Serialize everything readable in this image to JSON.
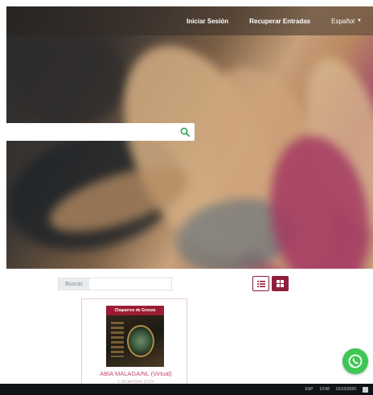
{
  "nav": {
    "login": "Iniciar Sesión",
    "recover": "Recuperar Entradas",
    "language": "Español"
  },
  "search": {
    "placeholder": "",
    "value": ""
  },
  "filter": {
    "label": "Buscar",
    "value": ""
  },
  "card": {
    "banner": "Chaparros de Gronzo",
    "title": "ABIA MALAGA/NL (Virtual)",
    "subtitle": "1 diciembre 2020"
  },
  "taskbar": {
    "lang": "ESP",
    "time": "13:58",
    "date": "01/12/2020"
  },
  "colors": {
    "brand": "#8f1f3c",
    "search_icon": "#2fa35b",
    "whatsapp": "#3ec754"
  },
  "icons": {
    "search": "magnifier-icon",
    "list_view": "list-icon",
    "grid_view": "grid-icon",
    "whatsapp": "whatsapp-icon"
  }
}
